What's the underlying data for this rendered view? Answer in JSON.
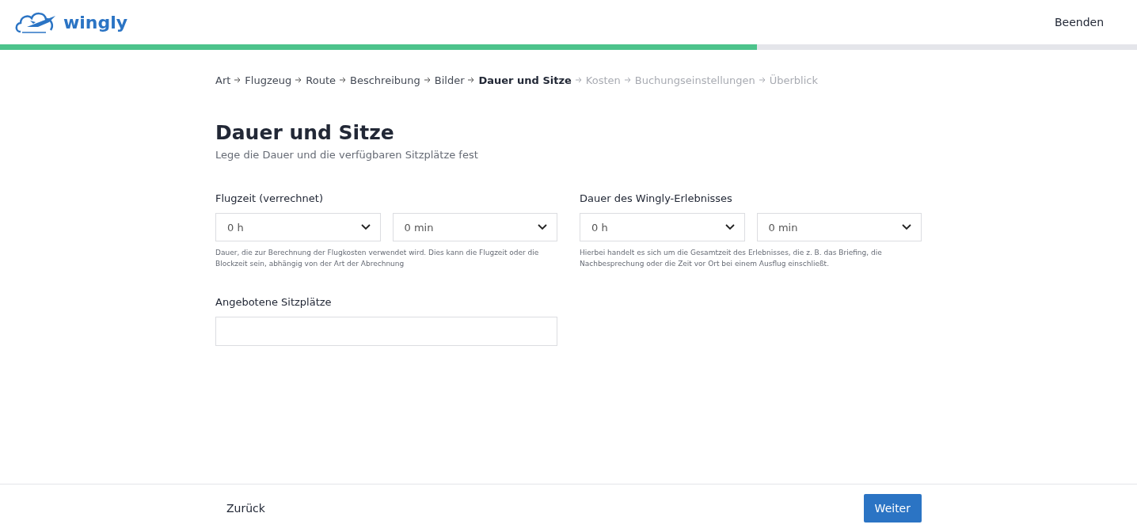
{
  "header": {
    "logo_text": "wingly",
    "exit_button": "Beenden"
  },
  "progress": {
    "level": 0.666
  },
  "breadcrumb": [
    {
      "label": "Art",
      "kind": "done"
    },
    {
      "label": "Flugzeug",
      "kind": "done"
    },
    {
      "label": "Route",
      "kind": "done"
    },
    {
      "label": "Beschreibung",
      "kind": "done"
    },
    {
      "label": "Bilder",
      "kind": "done"
    },
    {
      "label": "Dauer und Sitze",
      "kind": "current"
    },
    {
      "label": "Kosten",
      "kind": "upcoming"
    },
    {
      "label": "Buchungseinstellungen",
      "kind": "upcoming"
    },
    {
      "label": "Überblick",
      "kind": "upcoming"
    }
  ],
  "title": "Dauer und Sitze",
  "subtitle": "Lege die Dauer und die verfügbaren Sitzplätze fest",
  "duration_fields": [
    {
      "label": "Flugzeit (verrechnet)",
      "selects": [
        "0 h",
        "0 min"
      ],
      "help": "Dauer, die zur Berechnung der Flugkosten verwendet wird. Dies kann die Flugzeit oder die Blockzeit sein, abhängig von der Art der Abrechnung"
    },
    {
      "label": "Dauer des Wingly-Erlebnisses",
      "selects": [
        "0 h",
        "0 min"
      ],
      "help": "Hierbei handelt es sich um die Gesamtzeit des Erlebnisses, die z. B. das Briefing, die Nachbesprechung oder die Zeit vor Ort bei einem Ausflug einschließt."
    }
  ],
  "seats": {
    "label": "Angebotene Sitzplätze"
  },
  "footer": {
    "back": "Zurück",
    "next": "Weiter"
  }
}
